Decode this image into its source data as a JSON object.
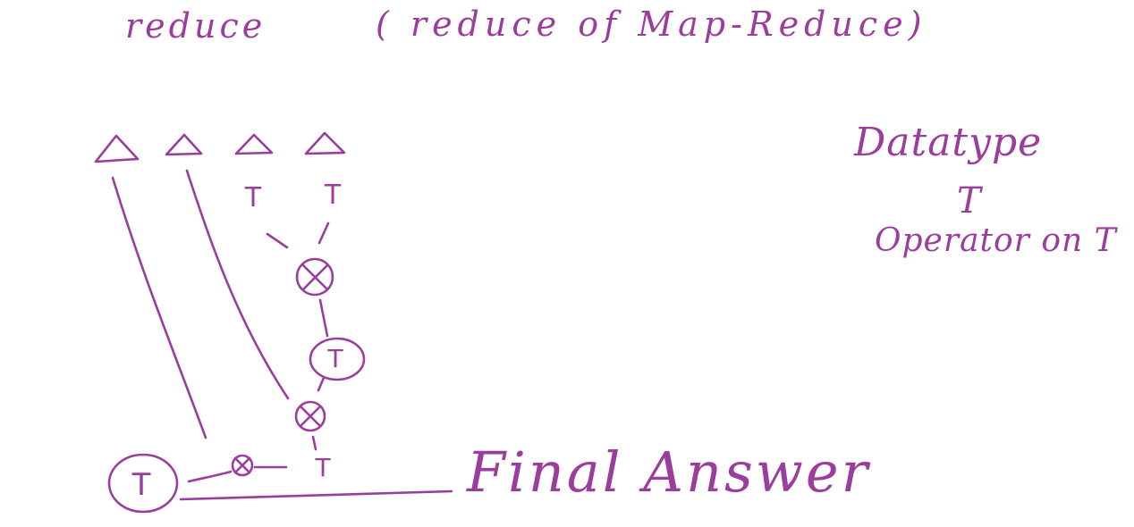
{
  "title": {
    "word": "reduce",
    "paren": "( reduce of Map-Reduce)"
  },
  "legend": {
    "title": "Datatype",
    "type_symbol": "T",
    "operator_text": "Operator on T"
  },
  "diagram": {
    "leaf_count": 4,
    "leaf_shape": "triangle",
    "pair_type_labels": [
      "T",
      "T"
    ],
    "operator_symbol": "⊗",
    "intermediate_type": "T",
    "lower_type": "T",
    "result_type": "T",
    "final_label": "Final Answer"
  },
  "colors": {
    "ink": "#9a3d9c",
    "background": "#ffffff"
  }
}
